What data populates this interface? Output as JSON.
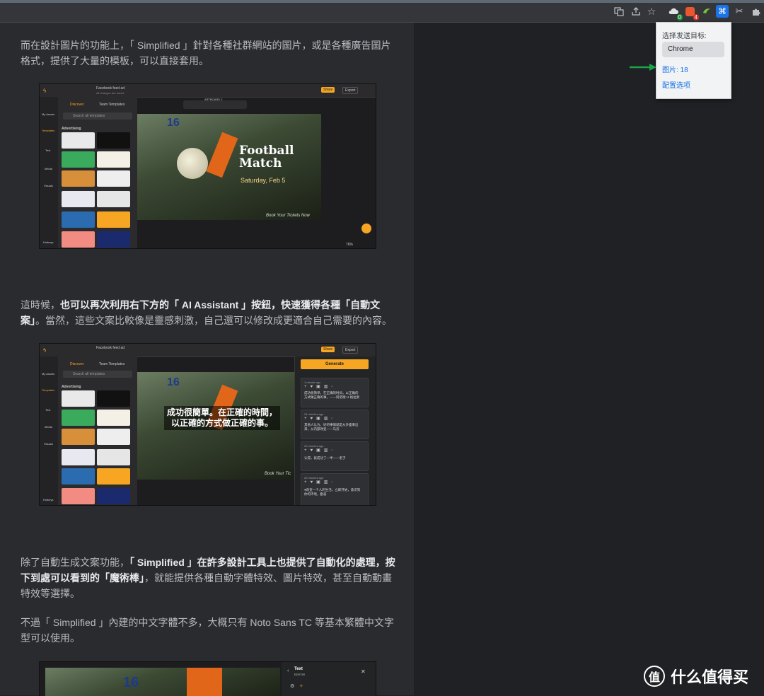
{
  "browser": {
    "ext_badges": {
      "cloud": "0",
      "red": "4"
    },
    "icons": [
      "translate-icon",
      "share-icon",
      "star-icon",
      "cloud-icon",
      "red-extension-icon",
      "green-extension-icon",
      "cmd-extension-icon",
      "scissors-extension-icon",
      "puzzle-icon"
    ]
  },
  "popup": {
    "label": "选择发送目标:",
    "option": "Chrome",
    "images_link": "图片: 18",
    "settings_link": "配置选项"
  },
  "article": {
    "p1_a": "而在設計圖片的功能上，「 Simplified 」針對各種社群網站的圖片，或是各種廣告圖片格式，提供了大量的模板，可以直接套用。",
    "p2_a": "這時候，",
    "p2_b": "也可以再次利用右下方的「 AI Assistant 」按鈕，快速獲得各種「自動文案」",
    "p2_c": "。當然，這些文案比較像是靈感刺激，自己還可以修改成更適合自己需要的內容。",
    "p3_a": "除了自動生成文案功能，",
    "p3_b": "「 Simplified 」在許多設計工具上也提供了自動化的處理，按下到處可以看到的「魔術棒」",
    "p3_c": "，就能提供各種自動字體特效、圖片特效，甚至自動動畫特效等選擇。",
    "p4": "不過「 Simplified 」內建的中文字體不多，大概只有 Noto Sans TC 等基本繁體中文字型可以使用。"
  },
  "screenshot1": {
    "doc_title": "Facebook feed ad",
    "doc_sub": "All changes are saved",
    "share": "Share",
    "export": "Export",
    "artboard": "ARTBOARD 2",
    "tabs": [
      "Discover",
      "Team Templates"
    ],
    "search_placeholder": "Search all templates",
    "category": "Advertising",
    "rail": [
      "My Assets",
      "Templates",
      "Text",
      "Media",
      "Visuals",
      "Hotkeys"
    ],
    "headline1": "Football",
    "headline2": "Match",
    "date": "Saturday, Feb 5",
    "cta": "Book Your Tickets Now",
    "zoom": "76%",
    "jersey": "16"
  },
  "screenshot2": {
    "doc_title": "Facebook feed ad",
    "share": "Share",
    "export": "Export",
    "tabs": [
      "Discover",
      "Team Templates"
    ],
    "search_placeholder": "Search all templates",
    "category": "Advertising",
    "rail": [
      "My Assets",
      "Templates",
      "Text",
      "Media",
      "Visuals",
      "Hotkeys"
    ],
    "quote_l1": "成功很簡單。在正確的時間，",
    "quote_l2": "以正確的方式做正確的事。",
    "cta": "Book Your Tic",
    "generate": "Generate",
    "cards": [
      {
        "time": "1 minute ago",
        "text": "成功很简单，在正确的时间，以正确的方式做正确的事。——阿诺德·H·格拉索"
      },
      {
        "time": "24 minutes ago",
        "text": "其他人认为，好的事情就是从外面来出来，从内部改变——马云"
      },
      {
        "time": "25 minutes ago",
        "text": "认得，就成功了一半——老子"
      },
      {
        "time": "25 minutes ago",
        "text": "●改变一个人的生活，立即开始，意识到你的环境，勤奋"
      }
    ],
    "jersey": "16"
  },
  "screenshot3": {
    "panel_title": "Text",
    "panel_sub": "EDITOR",
    "jersey": "16"
  },
  "watermark": {
    "logo": "值",
    "text": "什么值得买"
  }
}
